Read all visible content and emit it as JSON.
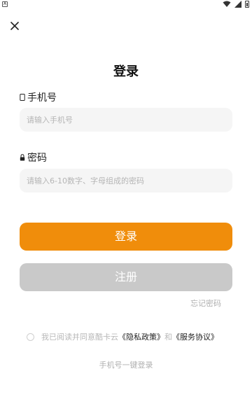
{
  "status_bar": {
    "left_icon": "A",
    "icons": [
      "wifi-icon",
      "cellular-signal-icon",
      "battery-icon"
    ]
  },
  "header": {
    "close_icon": "close-icon",
    "title": "登录"
  },
  "phone": {
    "label": "手机号",
    "icon": "phone-icon",
    "placeholder": "请输入手机号"
  },
  "password": {
    "label": "密码",
    "icon": "lock-icon",
    "placeholder": "请输入6-10数字、字母组成的密码"
  },
  "buttons": {
    "login": "登录",
    "register": "注册"
  },
  "forgot_password": "忘记密码",
  "agreement": {
    "prefix": "我已阅读并同意酷卡云",
    "privacy": "《隐私政策》",
    "and": "和",
    "service": "《服务协议》"
  },
  "quick_login": "手机号一键登录",
  "colors": {
    "primary": "#f08d0b",
    "disabled": "#c9c9c9",
    "input_bg": "#f5f5f5",
    "muted_text": "#b0b0b0"
  }
}
